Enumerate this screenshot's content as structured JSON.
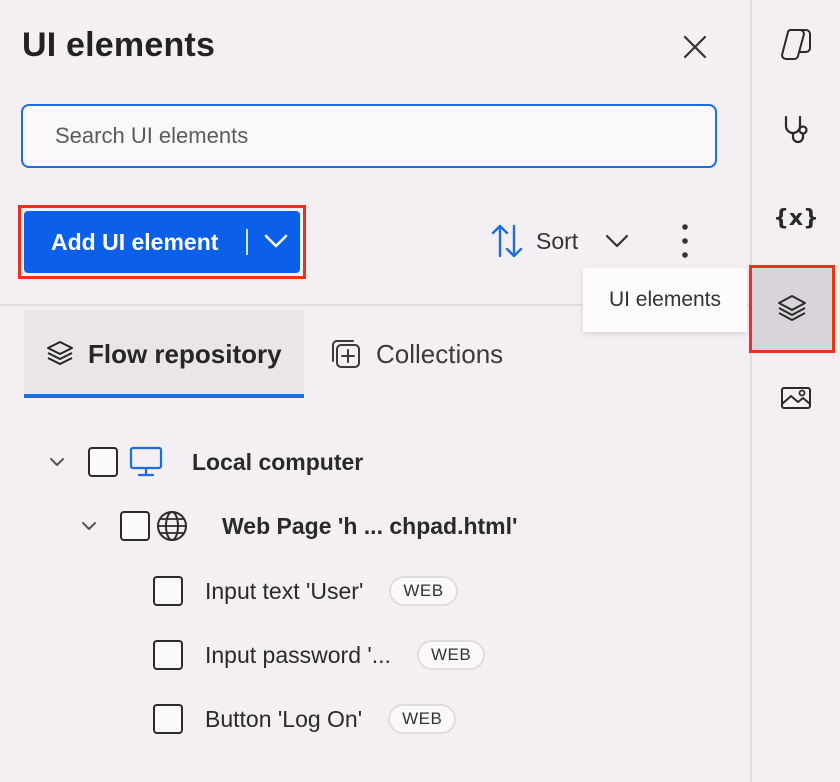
{
  "header": {
    "title": "UI elements"
  },
  "search": {
    "placeholder": "Search UI elements",
    "value": ""
  },
  "toolbar": {
    "add_label": "Add UI element",
    "sort_label": "Sort"
  },
  "tooltip": {
    "text": "UI elements"
  },
  "tabs": [
    {
      "label": "Flow repository",
      "icon": "layers-icon",
      "selected": true
    },
    {
      "label": "Collections",
      "icon": "collections-icon",
      "selected": false
    }
  ],
  "tree": {
    "root": {
      "label": "Local computer",
      "icon": "monitor-icon"
    },
    "page": {
      "label": "Web Page 'h ... chpad.html'",
      "icon": "globe-icon"
    },
    "elements": [
      {
        "label": "Input text 'User'",
        "badge": "WEB"
      },
      {
        "label": "Input password '...",
        "badge": "WEB"
      },
      {
        "label": "Button 'Log On'",
        "badge": "WEB"
      }
    ]
  },
  "rail": {
    "items": [
      {
        "icon": "copilot-icon"
      },
      {
        "icon": "stethoscope-icon"
      },
      {
        "icon": "variables-icon",
        "text": "{x}"
      },
      {
        "icon": "layers-icon",
        "selected": true
      },
      {
        "icon": "image-icon"
      }
    ]
  },
  "colors": {
    "accent": "#0b5fe8",
    "highlight": "#e8331c",
    "background": "#f3eff3"
  }
}
